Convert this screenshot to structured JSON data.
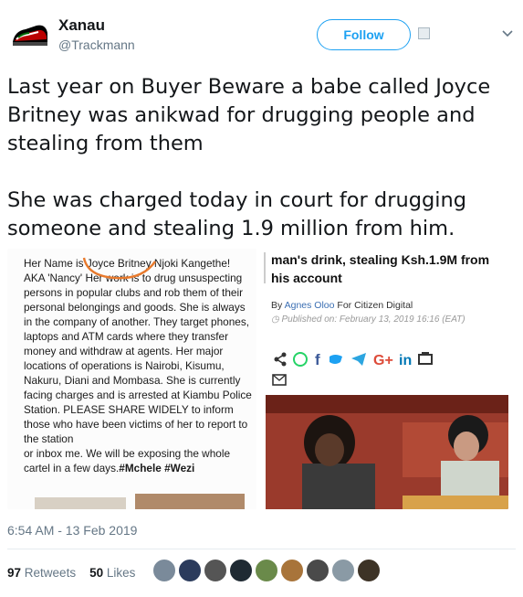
{
  "user": {
    "name": "Xanau",
    "handle": "@Trackmann"
  },
  "follow_label": "Follow",
  "tweet": {
    "line1": "Last year  on Buyer Beware a babe called Joyce Britney was anikwad for drugging people and stealing from them",
    "line2": "She was charged today in court for drugging someone and stealing 1.9 million from him."
  },
  "media": {
    "post_text": "Her Name is Joyce Britney Njoki Kangethe! AKA 'Nancy' Her work is to drug unsuspecting persons in popular clubs and rob them of their personal belongings and goods. She is always in the company of another. They target phones, laptops and ATM cards where they transfer money and withdraw at agents. Her major locations of operations is Nairobi, Kisumu, Nakuru, Diani and Mombasa. She is currently facing charges and is arrested at Kiambu Police Station. PLEASE SHARE WIDELY to inform those who have been victims of her to report to the station",
    "post_text2": "or inbox me.  We will be exposing the whole cartel in a few days.",
    "hashtags": "#Mchele #Wezi",
    "headline": "man's drink, stealing Ksh.1.9M from his account",
    "byline_prefix": "By",
    "author": "Agnes Oloo",
    "byline_suffix": "For Citizen Digital",
    "published": "Published on: February 13, 2019 16:16 (EAT)"
  },
  "timestamp": "6:54 AM - 13 Feb 2019",
  "stats": {
    "retweets_count": "97",
    "retweets_label": "Retweets",
    "likes_count": "50",
    "likes_label": "Likes"
  },
  "colors": {
    "accent": "#1da1f2",
    "muted": "#657786"
  }
}
